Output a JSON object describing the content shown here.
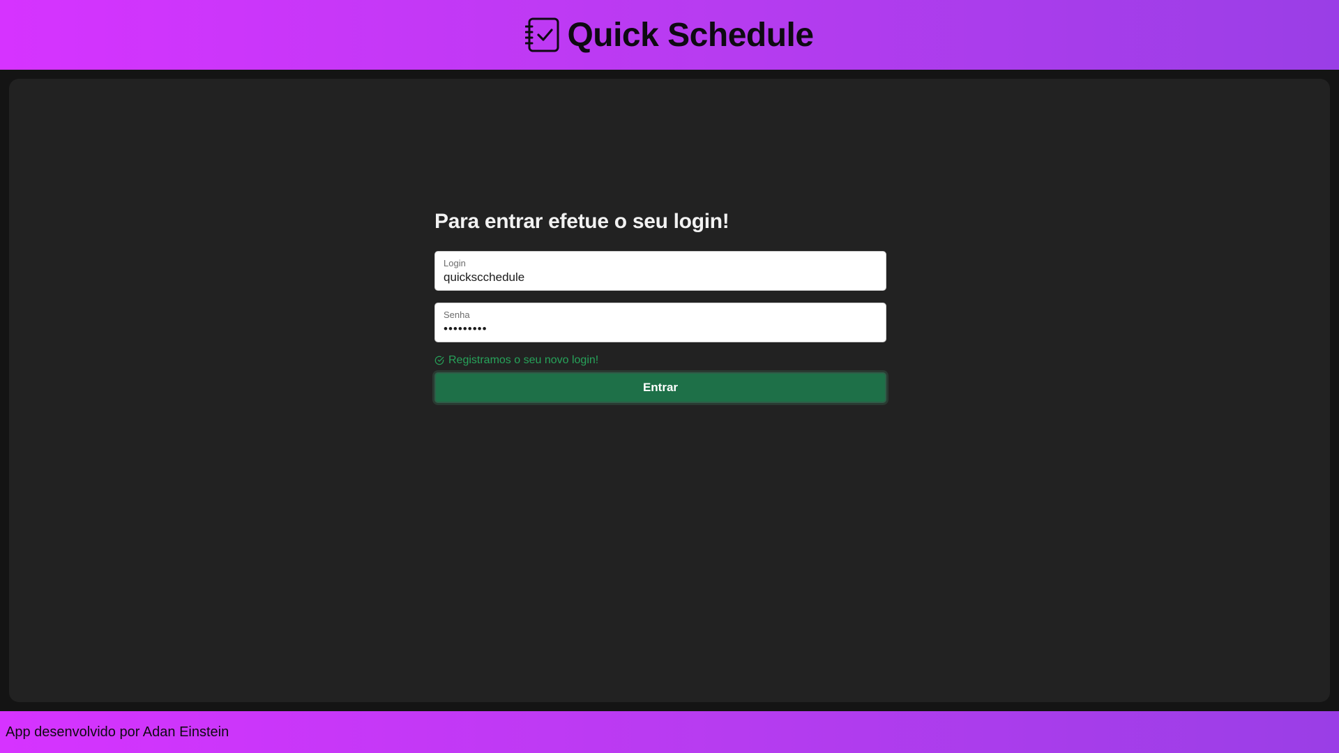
{
  "header": {
    "title": "Quick Schedule",
    "icon": "notebook-check-icon"
  },
  "login": {
    "title": "Para entrar efetue o seu login!",
    "login_field": {
      "label": "Login",
      "value": "quickscchedule"
    },
    "password_field": {
      "label": "Senha",
      "value": "•••••••••"
    },
    "success_message": "Registramos o seu novo login!",
    "success_icon": "check-circle-icon",
    "submit_label": "Entrar"
  },
  "footer": {
    "text": "App desenvolvido por Adan Einstein"
  },
  "colors": {
    "header_gradient_start": "#d633ff",
    "header_gradient_end": "#9a3ee6",
    "panel_bg": "#222222",
    "success_green": "#27a35a",
    "button_green": "#1e7048"
  }
}
